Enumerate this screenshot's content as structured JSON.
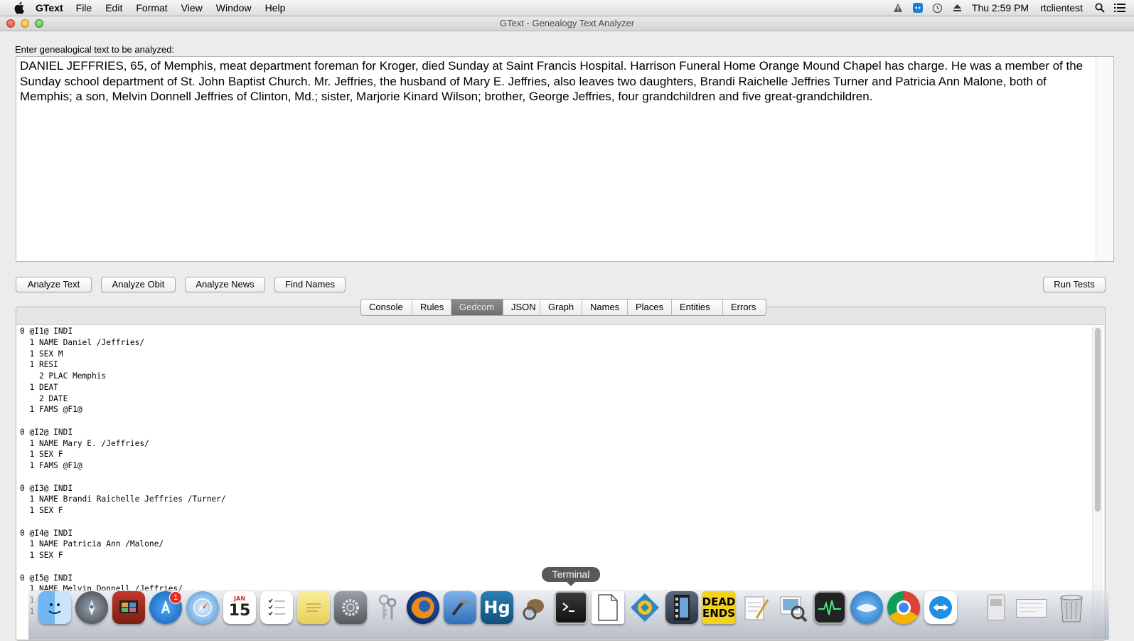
{
  "menubar": {
    "app_name": "GText",
    "menus": [
      "File",
      "Edit",
      "Format",
      "View",
      "Window",
      "Help"
    ],
    "clock": "Thu 2:59 PM",
    "user": "rtclientest"
  },
  "window": {
    "title": "GText - Genealogy Text Analyzer"
  },
  "input": {
    "label": "Enter genealogical text to be analyzed:",
    "text": "DANIEL JEFFRIES, 65, of Memphis, meat department foreman for Kroger, died Sunday at Saint Francis Hospital. Harrison Funeral Home Orange Mound Chapel has charge. He was a member of the Sunday school department of St. John Baptist Church. Mr. Jeffries, the husband of Mary E. Jeffries, also leaves two daughters, Brandi Raichelle Jeffries Turner and Patricia Ann Malone, both of Memphis; a son, Melvin Donnell Jeffries of Clinton, Md.; sister, Marjorie Kinard Wilson; brother, George Jeffries, four grandchildren and five great-grandchildren."
  },
  "buttons": {
    "analyze_text": "Analyze Text",
    "analyze_obit": "Analyze Obit",
    "analyze_news": "Analyze News",
    "find_names": "Find Names",
    "run_tests": "Run Tests"
  },
  "tabs": {
    "console": "Console",
    "rules": "Rules",
    "gedcom": "Gedcom",
    "json": "JSON",
    "graph": "Graph",
    "names": "Names",
    "places": "Places",
    "entities": "Entities",
    "errors": "Errors",
    "active": "Gedcom"
  },
  "output": {
    "gedcom": "0 @I1@ INDI\n  1 NAME Daniel /Jeffries/\n  1 SEX M\n  1 RESI\n    2 PLAC Memphis\n  1 DEAT\n    2 DATE\n  1 FAMS @F1@\n\n0 @I2@ INDI\n  1 NAME Mary E. /Jeffries/\n  1 SEX F\n  1 FAMS @F1@\n\n0 @I3@ INDI\n  1 NAME Brandi Raichelle Jeffries /Turner/\n  1 SEX F\n\n0 @I4@ INDI\n  1 NAME Patricia Ann /Malone/\n  1 SEX F\n\n0 @I5@ INDI\n  1 NAME Melvin Donnell /Jeffries/\n  1\n  1"
  },
  "dock": {
    "tooltip": "Terminal",
    "appstore_badge": "1",
    "calendar_day": "15",
    "calendar_month": "JAN",
    "hg_label": "Hg",
    "dead_ends_label_1": "DEAD",
    "dead_ends_label_2": "ENDS"
  }
}
